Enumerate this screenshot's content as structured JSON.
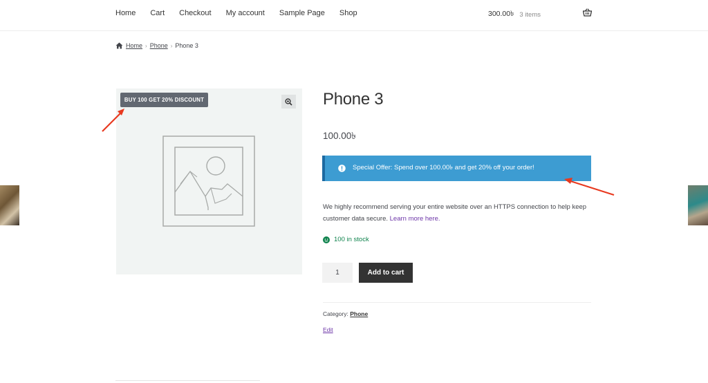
{
  "nav": {
    "items": [
      "Home",
      "Cart",
      "Checkout",
      "My account",
      "Sample Page",
      "Shop"
    ]
  },
  "cart": {
    "amount": "300.00৳",
    "count": "3 items",
    "icon": "basket-icon"
  },
  "breadcrumb": {
    "home": "Home",
    "category": "Phone",
    "current": "Phone 3",
    "separator": "›"
  },
  "product": {
    "badge": "BUY 100 GET 20% DISCOUNT",
    "title": "Phone 3",
    "price": "100.00৳",
    "notice": "Special Offer: Spend over 100.00৳  and get 20% off your order!",
    "description": "We highly recommend serving your entire website over an HTTPS connection to help keep customer data secure.",
    "learn_more": "Learn more here.",
    "stock": "100 in stock",
    "quantity": "1",
    "add_to_cart": "Add to cart",
    "category_label": "Category:",
    "category_value": "Phone",
    "edit": "Edit"
  },
  "colors": {
    "notice_bg": "#3d9cd2",
    "badge_bg": "#626871",
    "button_bg": "#333333",
    "stock_green": "#0f834d",
    "link_purple": "#6d36a8",
    "arrow_red": "#e8391f"
  }
}
